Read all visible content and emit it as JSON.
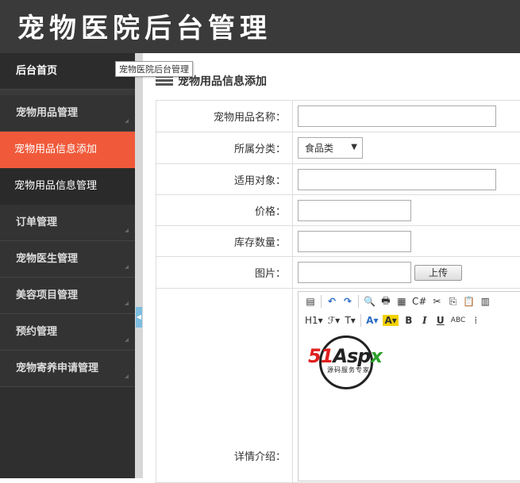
{
  "header": {
    "title": "宠物医院后台管理"
  },
  "tooltip": "宠物医院后台管理",
  "sidebar": {
    "home": "后台首页",
    "groups": [
      {
        "label": "宠物用品管理"
      },
      {
        "label": "订单管理"
      },
      {
        "label": "宠物医生管理"
      },
      {
        "label": "美容项目管理"
      },
      {
        "label": "预约管理"
      },
      {
        "label": "宠物寄养申请管理"
      }
    ],
    "subitems": [
      {
        "label": "宠物用品信息添加",
        "active": true
      },
      {
        "label": "宠物用品信息管理",
        "active": false
      }
    ]
  },
  "main": {
    "section_title": "宠物用品信息添加",
    "form": {
      "name_label": "宠物用品名称：",
      "category_label": "所属分类：",
      "category_value": "食品类",
      "target_label": "适用对象：",
      "price_label": "价格：",
      "stock_label": "库存数量：",
      "image_label": "图片：",
      "upload_button": "上传",
      "detail_label": "详情介绍："
    },
    "editor_toolbar": {
      "row1": [
        "▤",
        "↶",
        "↷",
        "🔍",
        "🖶",
        "▦",
        "C#",
        "✂",
        "⎘",
        "📋",
        "▥"
      ],
      "row2": [
        "H1▾",
        "ℱ▾",
        "T▾",
        "A▾",
        "A▾",
        "B",
        "I",
        "U",
        "ABC",
        "⁞"
      ]
    },
    "watermark": {
      "brand_a": "51",
      "brand_b": "Asp",
      "brand_c": "x",
      "tagline": "源码服务专家"
    }
  }
}
